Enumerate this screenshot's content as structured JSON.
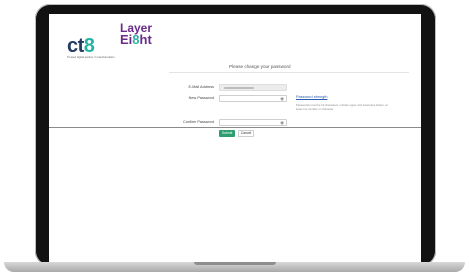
{
  "logos": {
    "cts": {
      "prefix": "ct",
      "accent": "8",
      "tagline": "Trusted digital partner in transformation"
    },
    "layer_eight": {
      "line1": "Layer",
      "line2_prefix": "Ei",
      "line2_accent": "8",
      "line2_suffix": "ht"
    }
  },
  "form": {
    "title": "Please change your password",
    "email_label": "E-Mail Address",
    "new_password_label": "New Password",
    "confirm_password_label": "Confirm Password",
    "password_strength_link": "Password strength",
    "help_text": "Passwords must be 10 characters, include upper and lowercase letters, at least one number or character",
    "submit_label": "Submit",
    "cancel_label": "Cancel",
    "eye_glyph": "◉"
  },
  "colors": {
    "submit": "#2f9e6f",
    "link": "#2a5db0",
    "cts_navy": "#233a63",
    "cts_teal": "#25b3a3",
    "layer8_purple": "#6b2c88"
  }
}
